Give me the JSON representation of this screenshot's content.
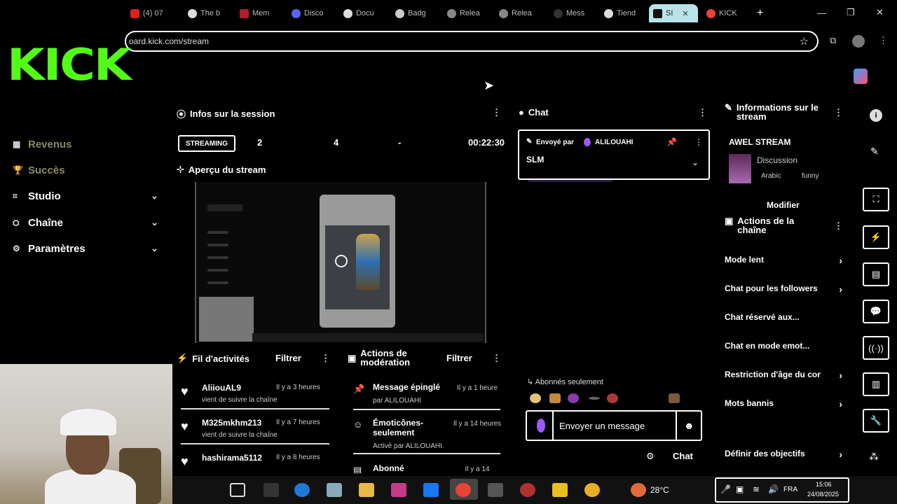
{
  "browser": {
    "tabs": [
      {
        "label": "(4) 07",
        "color": "#e0201b"
      },
      {
        "label": "The b",
        "color": "#dddddd"
      },
      {
        "label": "Mem",
        "color": "#b01e2a"
      },
      {
        "label": "Disco",
        "color": "#5865f2"
      },
      {
        "label": "Docu",
        "color": "#dddddd"
      },
      {
        "label": "Badg",
        "color": "#cccccc"
      },
      {
        "label": "Relea",
        "color": "#888888"
      },
      {
        "label": "Relea",
        "color": "#888888"
      },
      {
        "label": "Mess",
        "color": "#333333"
      },
      {
        "label": "Tiend",
        "color": "#dddddd"
      },
      {
        "label": "SI",
        "color": "#111111"
      },
      {
        "label": "KICK",
        "color": "#ea4335"
      }
    ],
    "new_tab": "+",
    "url": "oard.kick.com/stream",
    "star_icon": "star-icon"
  },
  "brand": {
    "logo": "KICK",
    "color": "#53fc18"
  },
  "sidebar": {
    "items": [
      {
        "label": "Revenus",
        "icon": "▦",
        "chev": ""
      },
      {
        "label": "Succès",
        "icon": "🏆",
        "chev": ""
      },
      {
        "label": "Studio",
        "icon": "⌗",
        "chev": "⌄"
      },
      {
        "label": "Chaîne",
        "icon": "⛭",
        "chev": "⌄"
      },
      {
        "label": "Paramètres",
        "icon": "⚙",
        "chev": "⌄"
      }
    ]
  },
  "session": {
    "title": "Infos sur la session",
    "badge": "STREAMING",
    "stats": [
      "2",
      "4",
      "-"
    ],
    "duration": "00:22:30",
    "preview_title": "Aperçu du stream"
  },
  "activity": {
    "title": "Fil d'activités",
    "filter": "Filtrer",
    "items": [
      {
        "name": "AliiouAL9",
        "time": "Il y a 3 heures",
        "sub": "vient de suivre la chaîne"
      },
      {
        "name": "M325mkhm213",
        "time": "Il y a 7 heures",
        "sub": "vient de suivre la chaîne"
      },
      {
        "name": "hashirama5112",
        "time": "Il y a 8 heures",
        "sub": ""
      }
    ]
  },
  "moderation": {
    "title": "Actions de modération",
    "filter": "Filtrer",
    "items": [
      {
        "title": "Message épinglé",
        "time": "Il y a 1 heure",
        "sub": "par ALILOUAHI"
      },
      {
        "title": "Émoticônes-seulement",
        "time": "Il y a 14 heures",
        "sub": "Activé par ALILOUAHI."
      },
      {
        "title": "Abonné",
        "time": "Il y a 14",
        "sub": ""
      }
    ]
  },
  "chat": {
    "title": "Chat",
    "pinned_by_label": "Envoyé par",
    "pinned_user": "ALILOUAHI",
    "pinned_message": "SLM",
    "subscribers_only": "Abonnés seulement",
    "input_placeholder": "Envoyer un message",
    "send_label": "Chat"
  },
  "stream_info": {
    "title": "Informations sur le stream",
    "stream_name": "AWEL STREAM",
    "category": "Discussion",
    "tags": [
      "Arabic",
      "funny"
    ],
    "edit": "Modifier"
  },
  "channel_actions": {
    "title": "Actions de la chaîne",
    "items": [
      {
        "label": "Mode lent",
        "chev": "›"
      },
      {
        "label": "Chat pour les followers",
        "chev": "›"
      },
      {
        "label": "Chat réservé aux...",
        "chev": ""
      },
      {
        "label": "Chat en mode emot...",
        "chev": ""
      },
      {
        "label": "Restriction d'âge du cor",
        "chev": "›"
      },
      {
        "label": "Mots bannis",
        "chev": "›"
      },
      {
        "label": "Définir des objectifs",
        "chev": "›"
      }
    ]
  },
  "taskbar": {
    "weather": "28°C",
    "lang": "FRA",
    "time": "15:06",
    "date": "24/08/2025"
  }
}
